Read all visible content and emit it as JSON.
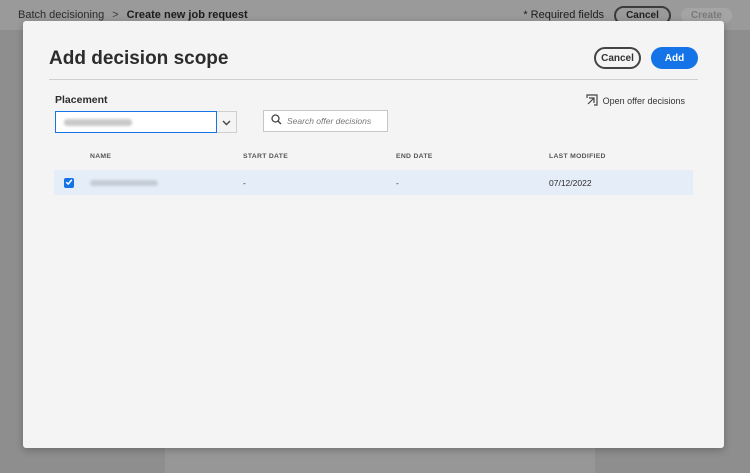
{
  "background": {
    "breadcrumb": {
      "parent": "Batch decisioning",
      "separator": ">",
      "current": "Create new job request"
    },
    "required_note": "* Required fields",
    "cancel_label": "Cancel",
    "create_label": "Create"
  },
  "modal": {
    "title": "Add decision scope",
    "cancel_label": "Cancel",
    "add_label": "Add",
    "placement_label": "Placement",
    "placement_value": "(blurred)",
    "search_placeholder": "Search offer decisions",
    "open_offer_label": "Open offer decisions",
    "table": {
      "headers": {
        "name": "NAME",
        "start_date": "START DATE",
        "end_date": "END DATE",
        "last_modified": "LAST MODIFIED"
      },
      "rows": [
        {
          "selected": true,
          "name": "(blurred)",
          "start_date": "-",
          "end_date": "-",
          "last_modified": "07/12/2022"
        }
      ]
    }
  },
  "colors": {
    "accent": "#1473e6",
    "overlay": "#8e8e8e",
    "modal_bg": "#f4f4f4",
    "selected_row": "#e5edf8"
  },
  "icons": {
    "search": "search-icon",
    "dropdown": "chevron-down-icon",
    "open_external": "open-in-icon",
    "checkbox": "checkmark-icon"
  }
}
